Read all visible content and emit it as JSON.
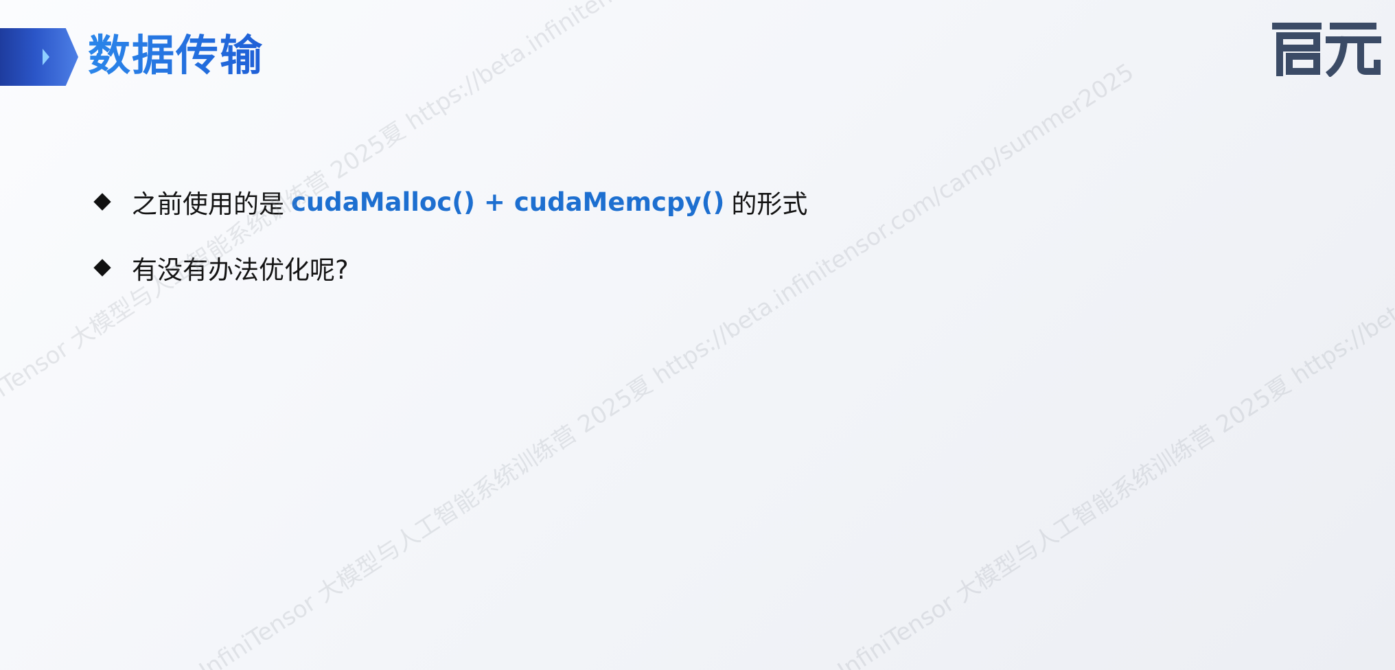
{
  "slide": {
    "title": "数据传输",
    "bullets": [
      {
        "pre": "之前使用的是",
        "code": "cudaMalloc() + cudaMemcpy()",
        "post": "的形式"
      },
      {
        "text": "有没有办法优化呢?"
      }
    ]
  },
  "logo": {
    "text": "启元",
    "icon": "qiyuan-logo-icon"
  },
  "watermark": {
    "text": "InfiniTensor 大模型与人工智能系统训练营 2025夏 https://beta.infinitensor.com/camp/summer2025"
  },
  "colors": {
    "title": "#1f6fe0",
    "code": "#1d6fd0",
    "arrow": "#2b56c8",
    "logo": "#3b4b66",
    "text": "#141414"
  }
}
